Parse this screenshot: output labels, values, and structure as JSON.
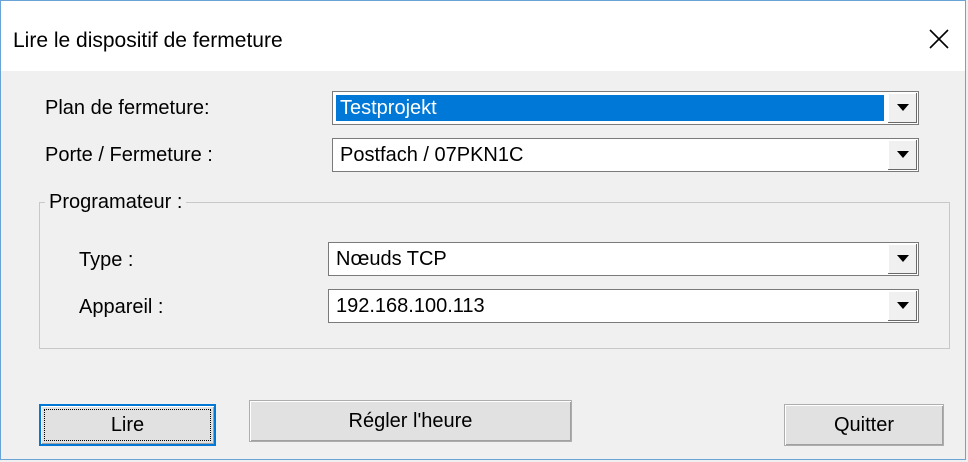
{
  "window": {
    "title": "Lire le dispositif de fermeture"
  },
  "form": {
    "locking_plan_label": "Plan de fermeture:",
    "locking_plan_value": "Testprojekt",
    "door_label": "Porte / Fermeture :",
    "door_value": "Postfach / 07PKN1C"
  },
  "programmer": {
    "group_label": "Programateur :",
    "type_label": "Type :",
    "type_value": "Nœuds TCP",
    "device_label": "Appareil :",
    "device_value": "192.168.100.113"
  },
  "buttons": {
    "read": "Lire",
    "set_time": "Régler l'heure",
    "quit": "Quitter"
  },
  "colors": {
    "selection": "#0078d7",
    "default_button_border": "#0078d7"
  },
  "icons": {
    "close": "close-icon",
    "dropdown": "chevron-down-icon"
  }
}
